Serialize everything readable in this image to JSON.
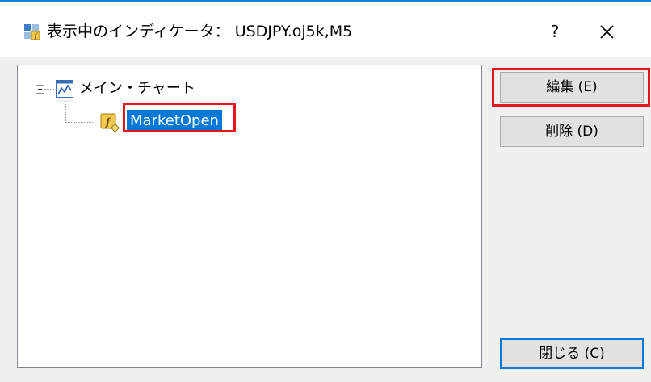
{
  "window": {
    "title": "表示中のインディケータ： USDJPY.oj5k,M5",
    "help_label": "?",
    "accent_color": "#1883d7"
  },
  "tree": {
    "root": {
      "label": "メイン・チャート",
      "icon": "chart-window-icon",
      "expanded": true
    },
    "children": [
      {
        "label": "MarketOpen",
        "icon": "function-icon",
        "selected": true
      }
    ],
    "selection_color": "#0078d7"
  },
  "buttons": {
    "edit": "編集 (E)",
    "delete": "削除 (D)",
    "close": "閉じる (C)"
  },
  "annotations": {
    "highlight_color": "#e8141c"
  }
}
